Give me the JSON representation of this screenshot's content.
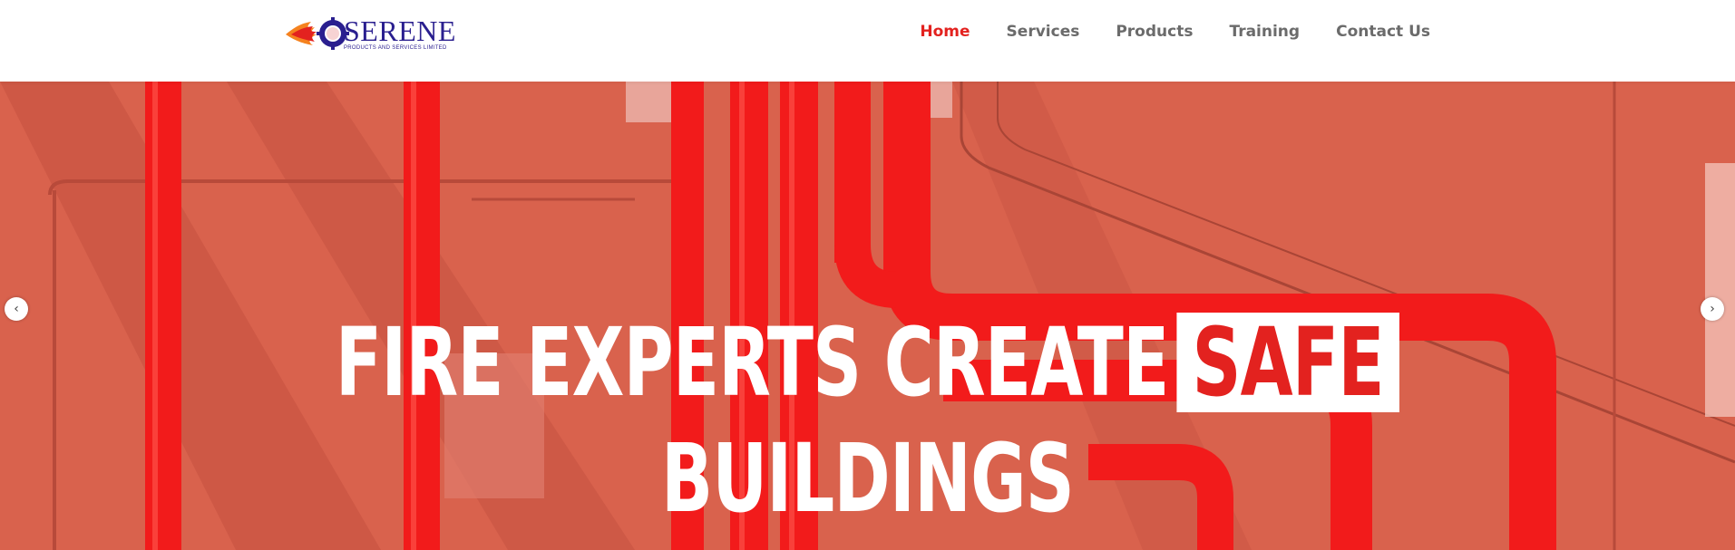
{
  "brand": {
    "name": "SERENE",
    "tagline": "PRODUCTS AND SERVICES LIMITED",
    "colors": {
      "primary": "#2a1f8f",
      "accent": "#e3221f"
    }
  },
  "nav": {
    "items": [
      {
        "label": "Home",
        "active": true
      },
      {
        "label": "Services",
        "active": false
      },
      {
        "label": "Products",
        "active": false
      },
      {
        "label": "Training",
        "active": false
      },
      {
        "label": "Contact Us",
        "active": false
      }
    ]
  },
  "hero": {
    "headline_part1": "FIRE EXPERTS CREATE",
    "headline_highlight": "SAFE",
    "headline_part2": "BUILDINGS",
    "prev_icon": "chevron-left-icon",
    "next_icon": "chevron-right-icon",
    "prev_glyph": "‹",
    "next_glyph": "›",
    "background_color": "#d9624d",
    "pipe_color": "#f21b1b"
  }
}
